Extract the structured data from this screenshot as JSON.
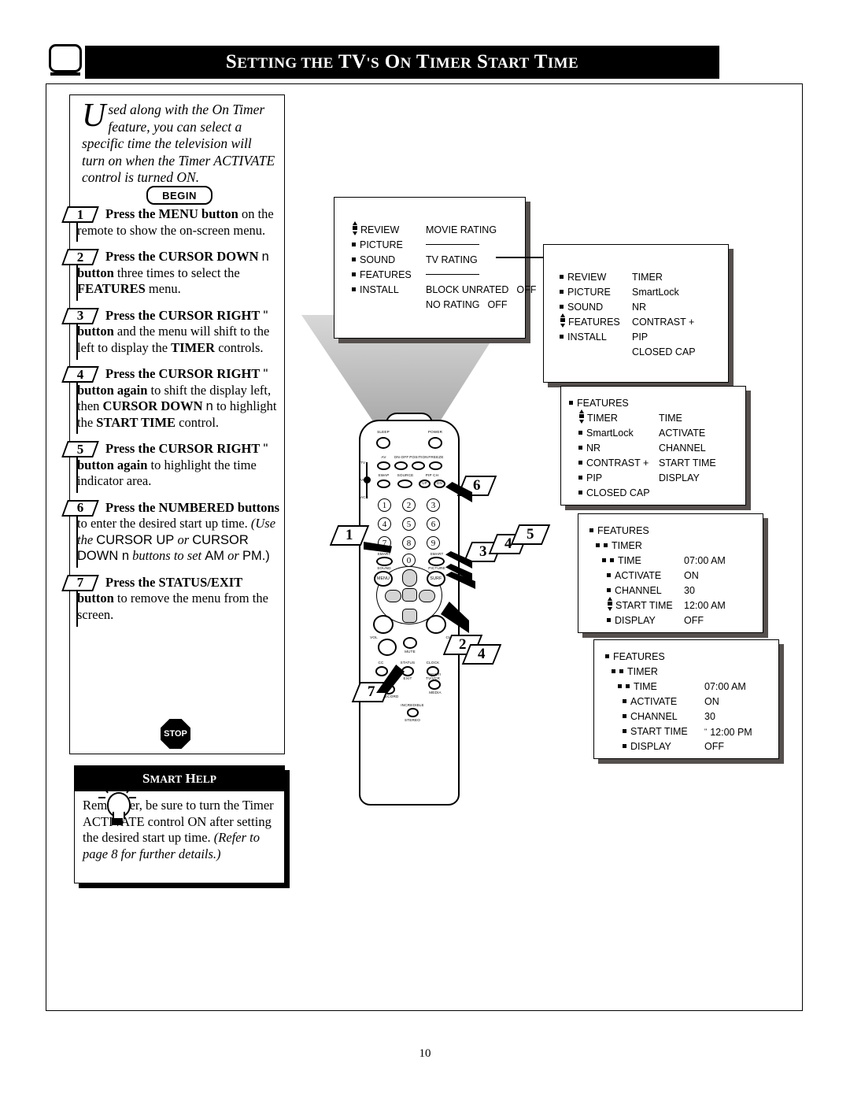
{
  "header": {
    "title_main": "ETTING THE ",
    "title_full": "SETTING THE TV'S ON TIMER START TIME",
    "s1": "S",
    "w1": "ETTING",
    "w2": "THE",
    "tv": "TV",
    "apos": "'",
    "s2": "S",
    "o": "O",
    "n": "N",
    "t1": "T",
    "imer": "IMER",
    "s3": "S",
    "tart": "TART",
    "t2": "T",
    "ime": "IME",
    "tv_icon": "tv-screen-icon"
  },
  "intro": {
    "dropcap": "U",
    "text": "sed along with the On Timer feature, you can select a specific time the television will turn on when the Timer ACTIVATE control is turned ON."
  },
  "begin_button": "BEGIN",
  "steps": [
    {
      "num": "1",
      "html": "<b>Press the MENU button</b> on the remote to show the on-screen menu."
    },
    {
      "num": "2",
      "html": "<b>Press the CURSOR DOWN</b> <span class=\"sans\">n</span> <b>button</b> three times to select the <b>FEATURES</b> menu."
    },
    {
      "num": "3",
      "html": "<b>Press the CURSOR RIGHT</b> <span class=\"sans\">\"</span> <b>button</b> and the menu will shift to the left to display the <b>TIMER</b> controls."
    },
    {
      "num": "4",
      "html": "<b>Press the CURSOR RIGHT</b> <span class=\"sans\">\"</span> <b>button again</b> to shift the display left, then <b>CURSOR DOWN</b> <span class=\"sans\">n</span> to highlight the <b>START TIME</b> control."
    },
    {
      "num": "5",
      "html": "<b>Press the CURSOR RIGHT</b> <span class=\"sans\">\"</span> <b>button again</b> to highlight the time indicator area."
    },
    {
      "num": "6",
      "html": "<b>Press the NUMBERED buttons</b> to enter the desired start up time. <span class=\"ital\">(Use the</span> <span class=\"sans\">CURSOR UP</span> <span class=\"ital\">or</span> <span class=\"sans\">CURSOR DOWN n</span> <span class=\"ital\">buttons to set</span> <span class=\"sans\">AM</span> <span class=\"ital\">or</span> <span class=\"sans\">PM.)</span>"
    },
    {
      "num": "7",
      "html": "<b>Press the STATUS/EXIT button</b> to remove the menu from the screen."
    }
  ],
  "stop_label": "STOP",
  "smart_help": {
    "heading_s": "S",
    "heading_mart": "MART",
    "heading_h": "H",
    "heading_elp": "ELP",
    "heading": "SMART HELP",
    "body_plain": "Remember, be sure to turn the Timer ACTIVATE control ON after setting the desired start up time. ",
    "body_italic": "(Refer to page 8 for further details.)"
  },
  "menu_screens": [
    {
      "id": "screen-1-movie-rating",
      "left_column": [
        "REVIEW",
        "PICTURE",
        "SOUND",
        "FEATURES",
        "INSTALL"
      ],
      "right_column": [
        {
          "label": "MOVIE RATING",
          "value": ""
        },
        {
          "label": "————",
          "value": ""
        },
        {
          "label": "TV RATING",
          "value": ""
        },
        {
          "label": "————",
          "value": ""
        },
        {
          "label": "BLOCK UNRATED",
          "value": "OFF"
        },
        {
          "label": "NO RATING",
          "value": "OFF"
        }
      ],
      "cursor_on": "REVIEW"
    },
    {
      "id": "screen-2-features-list",
      "left_column": [
        "REVIEW",
        "PICTURE",
        "SOUND",
        "FEATURES",
        "INSTALL"
      ],
      "right_column": [
        {
          "label": "TIMER",
          "value": ""
        },
        {
          "label": "SmartLock",
          "value": ""
        },
        {
          "label": "NR",
          "value": ""
        },
        {
          "label": "CONTRAST +",
          "value": ""
        },
        {
          "label": "PIP",
          "value": ""
        },
        {
          "label": "CLOSED CAP",
          "value": ""
        }
      ],
      "cursor_on": "FEATURES"
    },
    {
      "id": "screen-3-timer-submenu",
      "title": "FEATURES",
      "left_column": [
        "TIMER",
        "SmartLock",
        "NR",
        "CONTRAST +",
        "PIP",
        "CLOSED CAP"
      ],
      "right_column": [
        {
          "label": "TIME",
          "value": ""
        },
        {
          "label": "ACTIVATE",
          "value": ""
        },
        {
          "label": "CHANNEL",
          "value": ""
        },
        {
          "label": "START TIME",
          "value": ""
        },
        {
          "label": "DISPLAY",
          "value": ""
        }
      ],
      "cursor_on": "TIMER"
    },
    {
      "id": "screen-4-start-time-am",
      "title": "FEATURES",
      "subtitle": "TIMER",
      "rows": [
        {
          "label": "TIME",
          "value": "07:00 AM"
        },
        {
          "label": "ACTIVATE",
          "value": "ON"
        },
        {
          "label": "CHANNEL",
          "value": "30"
        },
        {
          "label": "START TIME",
          "value": "12:00 AM"
        },
        {
          "label": "DISPLAY",
          "value": "OFF"
        }
      ],
      "cursor_on": "START TIME"
    },
    {
      "id": "screen-5-start-time-pm",
      "title": "FEATURES",
      "subtitle": "TIMER",
      "rows": [
        {
          "label": "TIME",
          "value": "07:00 AM"
        },
        {
          "label": "ACTIVATE",
          "value": "ON"
        },
        {
          "label": "CHANNEL",
          "value": "30"
        },
        {
          "label": "START TIME",
          "value": "12:00 PM"
        },
        {
          "label": "DISPLAY",
          "value": "OFF"
        }
      ],
      "cursor_on": "START TIME"
    }
  ],
  "remote": {
    "top_labels": [
      {
        "text": "SLEEP"
      },
      {
        "text": "POWER"
      },
      {
        "text": "AV"
      },
      {
        "text": "ON-OFF"
      },
      {
        "text": "POSITION"
      },
      {
        "text": "FREEZE"
      },
      {
        "text": "SWAP"
      },
      {
        "text": "SOURCE"
      },
      {
        "text": "PIP CH"
      },
      {
        "text": "UP"
      },
      {
        "text": "DN"
      }
    ],
    "mode_labels": [
      "TV",
      "VCR",
      "ACC"
    ],
    "numbers": [
      "1",
      "2",
      "3",
      "4",
      "5",
      "6",
      "7",
      "8",
      "9",
      "0"
    ],
    "mid_labels": [
      "SMART",
      "SOUND",
      "SMART",
      "PICTURE",
      "MENU",
      "SURF"
    ],
    "bottom_labels": [
      "VOL",
      "CH",
      "MUTE",
      "CC",
      "STATUS",
      "EXIT",
      "CLOCK",
      "TV/VCR",
      "RECORD",
      "MULTI",
      "MEDIA",
      "INCREDIBLE",
      "STEREO"
    ]
  },
  "callouts": [
    "1",
    "2",
    "3",
    "4",
    "5",
    "6",
    "7"
  ],
  "page_number": "10"
}
